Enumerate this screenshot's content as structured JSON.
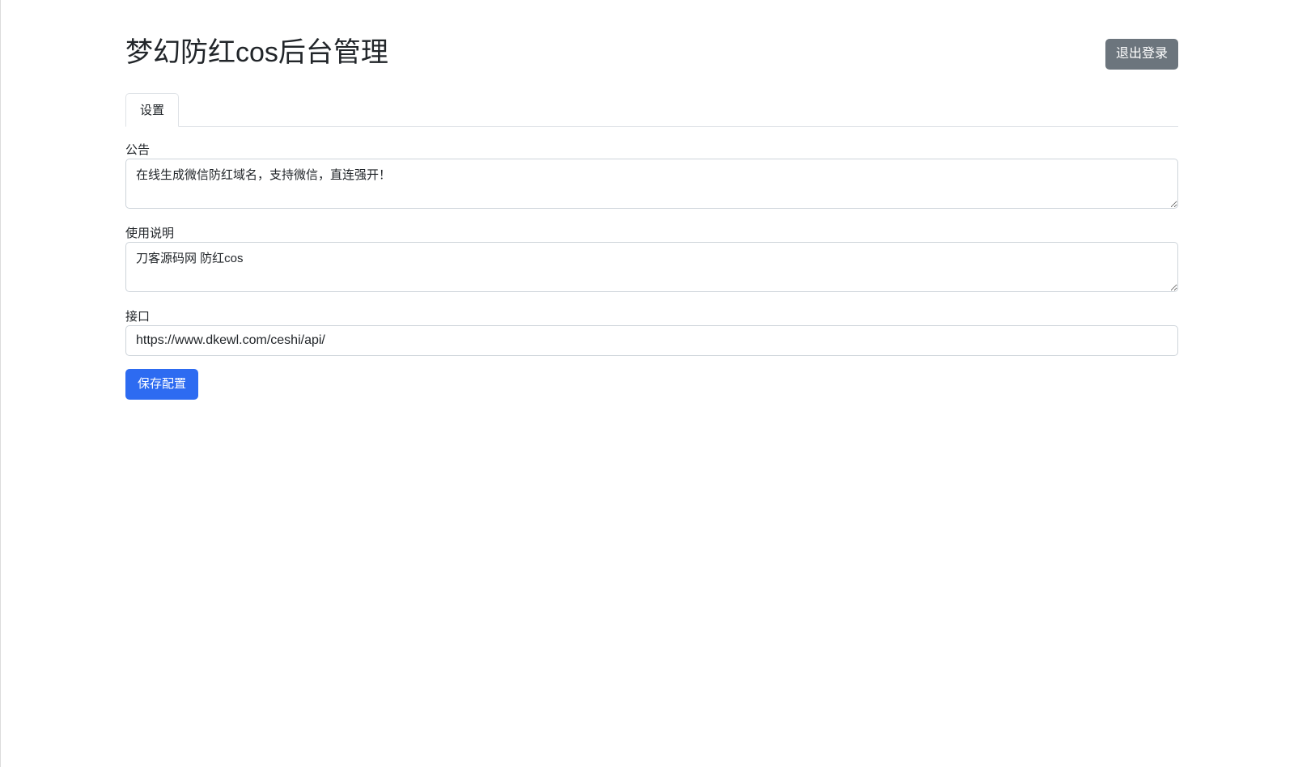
{
  "header": {
    "title": "梦幻防红cos后台管理",
    "logout_label": "退出登录"
  },
  "tabs": [
    {
      "label": "设置",
      "active": true
    }
  ],
  "form": {
    "notice": {
      "label": "公告",
      "value": "在线生成微信防红域名，支持微信，直连强开！"
    },
    "instructions": {
      "label": "使用说明",
      "value": "刀客源码网 防红cos"
    },
    "api": {
      "label": "接口",
      "value": "https://www.dkewl.com/ceshi/api/"
    },
    "save_label": "保存配置"
  },
  "colors": {
    "primary": "#2d6bf1",
    "secondary": "#6c757d"
  }
}
